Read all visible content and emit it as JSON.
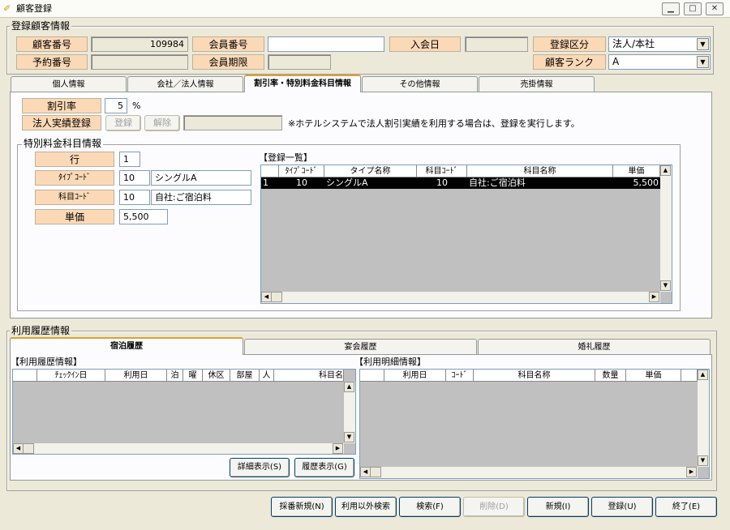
{
  "window": {
    "title": "顧客登録"
  },
  "customer": {
    "group_label": "登録顧客情報",
    "customer_no_label": "顧客番号",
    "customer_no": "109984",
    "member_no_label": "会員番号",
    "member_no": "",
    "join_date_label": "入会日",
    "join_date": "",
    "reg_type_label": "登録区分",
    "reg_type": "法人/本社",
    "booking_no_label": "予約番号",
    "booking_no": "",
    "member_expiry_label": "会員期限",
    "member_expiry": "",
    "rank_label": "顧客ランク",
    "rank": "A"
  },
  "tabs": [
    {
      "label": "個人情報"
    },
    {
      "label": "会社／法人情報"
    },
    {
      "label": "割引率・特別料金科目情報"
    },
    {
      "label": "その他情報"
    },
    {
      "label": "売掛情報"
    }
  ],
  "discount": {
    "rate_label": "割引率",
    "rate": "5",
    "rate_unit": "%",
    "corp_label": "法人実績登録",
    "register_btn": "登録",
    "cancel_btn": "解除",
    "corp_value": "",
    "note": "※ホテルシステムで法人割引実績を利用する場合は、登録を実行します。"
  },
  "special": {
    "group_label": "特別料金科目情報",
    "row_label": "行",
    "row": "1",
    "type_code_label": "ﾀｲﾌﾟｺｰﾄﾞ",
    "type_code": "10",
    "type_name": "シングルA",
    "item_code_label": "科目ｺｰﾄﾞ",
    "item_code": "10",
    "item_name": "自社:ご宿泊料",
    "price_label": "単価",
    "price": "5,500"
  },
  "reg_list": {
    "title": "【登録一覧】",
    "columns": [
      "ﾀｲﾌﾟｺｰﾄﾞ",
      "タイプ名称",
      "科目ｺｰﾄﾞ",
      "科目名称",
      "単価"
    ],
    "rows": [
      {
        "no": "1",
        "type_code": "10",
        "type_name": "シングルA",
        "item_code": "10",
        "item_name": "自社:ご宿泊料",
        "price": "5,500"
      }
    ]
  },
  "history": {
    "group_label": "利用履歴情報",
    "tabs": [
      {
        "label": "宿泊履歴"
      },
      {
        "label": "宴会履歴"
      },
      {
        "label": "婚礼履歴"
      }
    ],
    "left_title": "【利用履歴情報】",
    "left_columns": [
      "ﾁｪｯｸｲﾝ日",
      "利用日",
      "泊",
      "曜",
      "休区",
      "部屋",
      "人",
      "科目名"
    ],
    "right_title": "【利用明細情報】",
    "right_columns": [
      "利用日",
      "ｺｰﾄﾞ",
      "科目名称",
      "数量",
      "単価"
    ],
    "detail_btn": "詳細表示(S)",
    "history_btn": "履歴表示(G)"
  },
  "footer": {
    "buttons": [
      "採番新規(N)",
      "利用以外検索",
      "検索(F)",
      "削除(D)",
      "新規(I)",
      "登録(U)",
      "終了(E)"
    ]
  }
}
